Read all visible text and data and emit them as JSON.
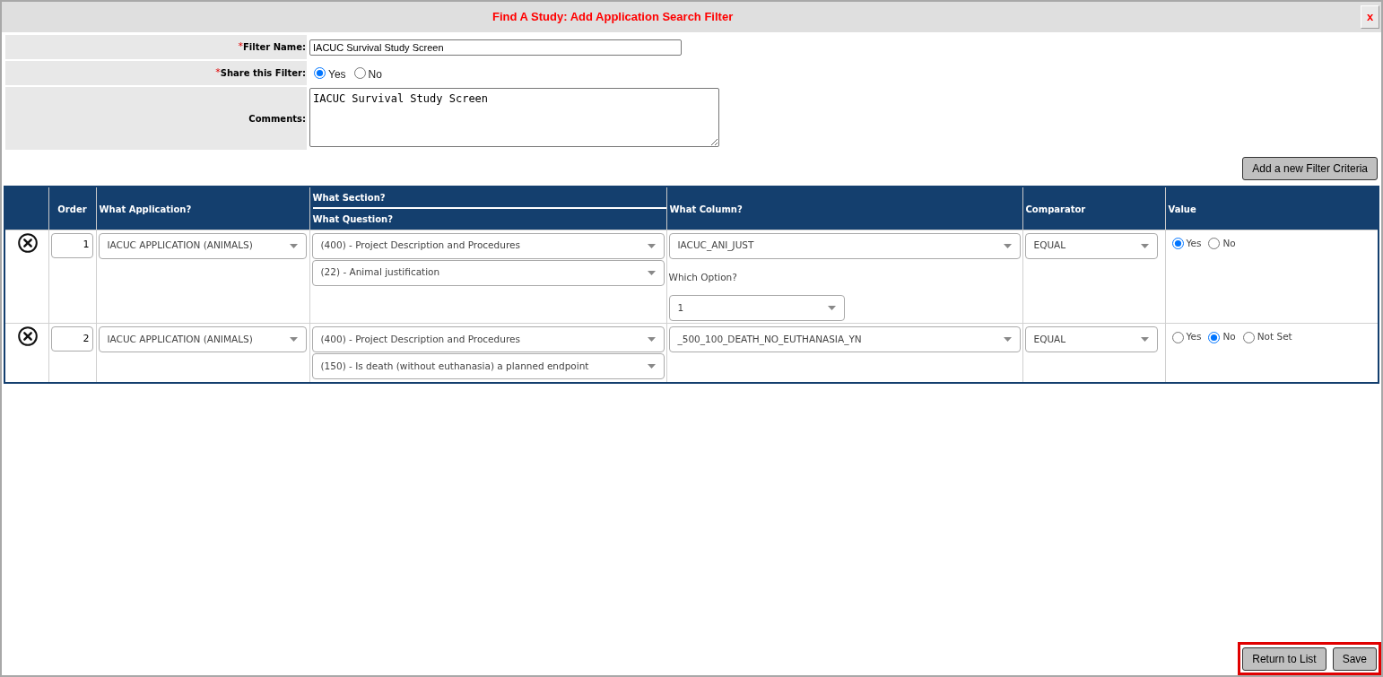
{
  "dialog": {
    "title": "Find A Study: Add Application Search Filter",
    "close_label": "x"
  },
  "form": {
    "filter_name": {
      "required_mark": "*",
      "label": "Filter Name:",
      "value": "IACUC Survival Study Screen"
    },
    "share_filter": {
      "required_mark": "*",
      "label": "Share this Filter:",
      "options": [
        {
          "label": "Yes",
          "selected": true
        },
        {
          "label": "No",
          "selected": false
        }
      ]
    },
    "comments": {
      "label": "Comments:",
      "value": "IACUC Survival Study Screen"
    }
  },
  "add_button": "Add a new Filter Criteria",
  "table": {
    "columns": [
      {
        "kind": "single",
        "label": "Order"
      },
      {
        "kind": "single",
        "label": "What Application?"
      },
      {
        "kind": "stacked",
        "labels": [
          "What Section?",
          "What Question?"
        ]
      },
      {
        "kind": "single",
        "label": "What Column?"
      },
      {
        "kind": "single",
        "label": "Comparator"
      },
      {
        "kind": "single",
        "label": "Value"
      }
    ],
    "rows": [
      {
        "order": "1",
        "application": "IACUC APPLICATION (ANIMALS)",
        "section": "(400) - Project Description and Procedures",
        "question": "(22) - Animal justification",
        "column": "IACUC_ANI_JUST",
        "option_label": "Which Option?",
        "option": "1",
        "comparator": "EQUAL",
        "values": [
          {
            "label": "Yes",
            "selected": true
          },
          {
            "label": "No",
            "selected": false
          }
        ]
      },
      {
        "order": "2",
        "application": "IACUC APPLICATION (ANIMALS)",
        "section": "(400) - Project Description and Procedures",
        "question": "(150) - Is death (without euthanasia) a planned endpoint",
        "column": "_500_100_DEATH_NO_EUTHANASIA_YN",
        "comparator": "EQUAL",
        "values": [
          {
            "label": "Yes",
            "selected": false
          },
          {
            "label": "No",
            "selected": true
          },
          {
            "label": "Not Set",
            "selected": false
          }
        ]
      }
    ]
  },
  "footer": {
    "buttons": [
      "Return to List",
      "Save"
    ]
  }
}
